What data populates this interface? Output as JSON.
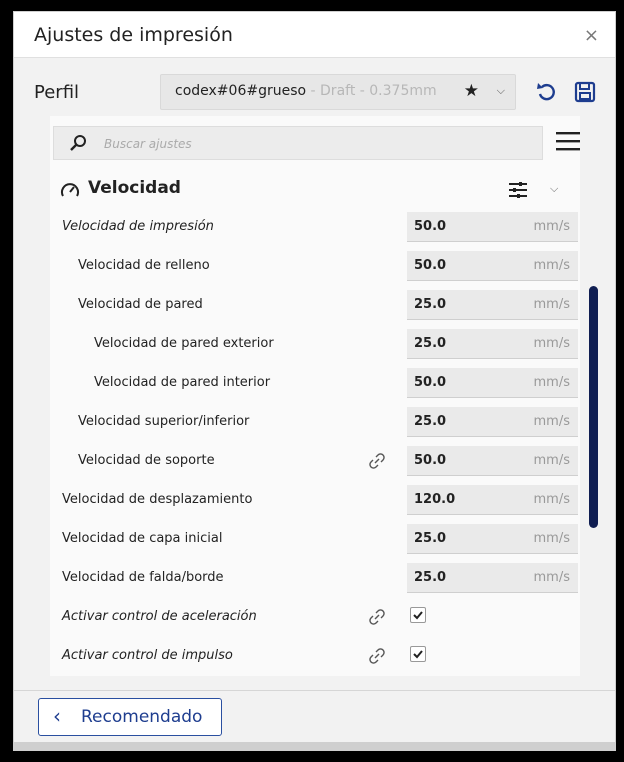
{
  "window": {
    "title": "Ajustes de impresión",
    "close_glyph": "×"
  },
  "profile": {
    "label": "Perfil",
    "name": "codex#06#grueso",
    "suffix": " - Draft - 0.375mm"
  },
  "search": {
    "placeholder": "Buscar ajustes"
  },
  "section": {
    "title": "Velocidad"
  },
  "rows": [
    {
      "label": "Velocidad de impresión",
      "value": "50.0",
      "unit": "mm/s",
      "italic": true
    },
    {
      "label": "Velocidad de relleno",
      "value": "50.0",
      "unit": "mm/s"
    },
    {
      "label": "Velocidad de pared",
      "value": "25.0",
      "unit": "mm/s"
    },
    {
      "label": "Velocidad de pared exterior",
      "value": "25.0",
      "unit": "mm/s"
    },
    {
      "label": "Velocidad de pared interior",
      "value": "50.0",
      "unit": "mm/s"
    },
    {
      "label": "Velocidad superior/inferior",
      "value": "25.0",
      "unit": "mm/s"
    },
    {
      "label": "Velocidad de soporte",
      "value": "50.0",
      "unit": "mm/s",
      "link": true
    },
    {
      "label": "Velocidad de desplazamiento",
      "value": "120.0",
      "unit": "mm/s"
    },
    {
      "label": "Velocidad de capa inicial",
      "value": "25.0",
      "unit": "mm/s"
    },
    {
      "label": "Velocidad de falda/borde",
      "value": "25.0",
      "unit": "mm/s"
    },
    {
      "label": "Activar control de aceleración",
      "checked": true,
      "link": true,
      "italic": true
    },
    {
      "label": "Activar control de impulso",
      "checked": true,
      "link": true,
      "italic": true
    }
  ],
  "footer": {
    "recommended_label": "Recomendado"
  },
  "colors": {
    "accent": "#1e3d8f",
    "scrollbar": "#101e52"
  }
}
